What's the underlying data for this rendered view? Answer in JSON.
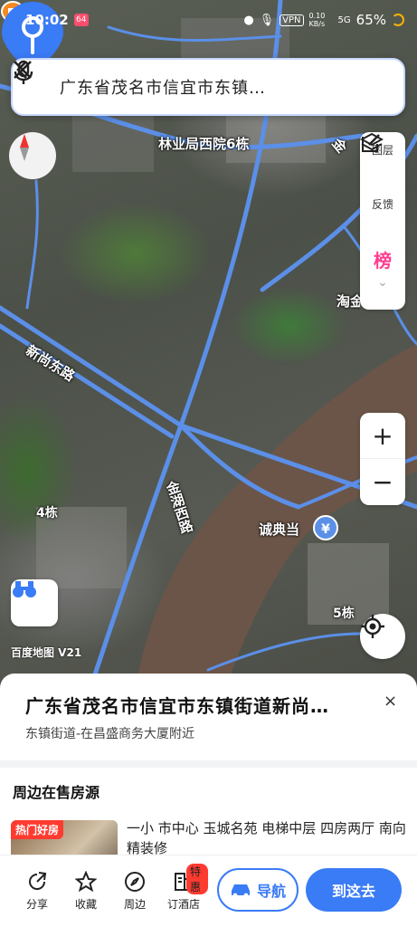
{
  "status_bar": {
    "time": "10:02",
    "app_badge": "64",
    "network": "VPN",
    "speed": "0.10 KB/s",
    "signal": "5G",
    "battery": "65%"
  },
  "search": {
    "query": "广东省茂名市信宜市东镇…"
  },
  "map": {
    "labels": {
      "forestry_building": "林业局西院6栋",
      "xinshang_road": "新尚东路",
      "jinhu_west_road": "金湖西路",
      "jin_road_fragment": "金",
      "building_4": "4栋",
      "building_5": "5栋",
      "pawn_shop": "诚典当",
      "taojin_fragment": "淘金湾公园",
      "logo": "百度地图 V21"
    },
    "poi_yuan_symbol": "¥",
    "poi_orange_symbol": "⌂"
  },
  "right_panel": {
    "layers_label": "图层",
    "feedback_label": "反馈",
    "rank_label": "榜"
  },
  "zoom": {
    "plus": "+",
    "minus": "−"
  },
  "place": {
    "title": "广东省茂名市信宜市东镇街道新尚…",
    "subtitle": "东镇街道-在昌盛商务大厦附近",
    "close": "×"
  },
  "housing": {
    "section_title": "周边在售房源",
    "tag": "热门好房",
    "description": "一小 市中心 玉城名苑 电梯中层 四房两厅 南向 精装修"
  },
  "toolbar": {
    "share": "分享",
    "collect": "收藏",
    "nearby": "周边",
    "hotel": "订酒店",
    "hotel_badge": "特惠",
    "navigate": "导航",
    "go_here": "到这去"
  },
  "colors": {
    "accent": "#3a7bf6",
    "road": "#5b8fe8",
    "river": "#6b5548",
    "badge": "#ff3b30"
  }
}
